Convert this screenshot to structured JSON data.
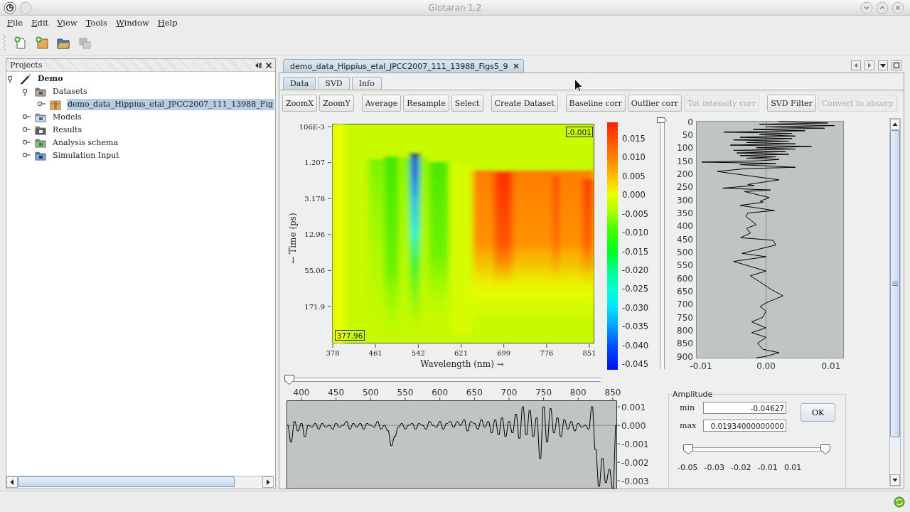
{
  "window": {
    "title": "Glotaran 1.2"
  },
  "menu": [
    "File",
    "Edit",
    "View",
    "Tools",
    "Window",
    "Help"
  ],
  "toolbar": [
    {
      "kind": "add-document",
      "disabled": false
    },
    {
      "kind": "add-folder",
      "disabled": false
    },
    {
      "kind": "folder",
      "disabled": false
    },
    {
      "kind": "windows",
      "disabled": true
    }
  ],
  "projects_panel": {
    "title": "Projects",
    "tree": [
      {
        "label": "Demo",
        "kind": "project",
        "expanded": true,
        "selected": false,
        "children": [
          {
            "label": "Datasets",
            "kind": "datasets",
            "expanded": true,
            "selected": false,
            "children": [
              {
                "label": "demo_data_Hippius_etal_JPCC2007_111_13988_Fig",
                "kind": "dataset",
                "expanded": false,
                "selected": true
              }
            ]
          },
          {
            "label": "Models",
            "kind": "models",
            "expanded": false,
            "selected": false
          },
          {
            "label": "Results",
            "kind": "results",
            "expanded": false,
            "selected": false
          },
          {
            "label": "Analysis schema",
            "kind": "schema",
            "expanded": false,
            "selected": false
          },
          {
            "label": "Simulation Input",
            "kind": "simulation",
            "expanded": false,
            "selected": false
          }
        ]
      }
    ]
  },
  "editor_tab": {
    "title": "demo_data_Hippius_etal_JPCC2007_111_13988_Figs5_9"
  },
  "view_tabs": [
    {
      "label": "Data",
      "selected": true
    },
    {
      "label": "SVD",
      "selected": false
    },
    {
      "label": "Info",
      "selected": false
    }
  ],
  "button_groups": [
    [
      {
        "label": "ZoomX",
        "disabled": false
      },
      {
        "label": "ZoomY",
        "disabled": false
      }
    ],
    [
      {
        "label": "Average",
        "disabled": false
      },
      {
        "label": "Resample",
        "disabled": false
      },
      {
        "label": "Select",
        "disabled": false
      }
    ],
    [
      {
        "label": "Create Dataset",
        "disabled": false
      }
    ],
    [
      {
        "label": "Baseline corr",
        "disabled": false
      },
      {
        "label": "Outlier corr",
        "disabled": false
      },
      {
        "label": "Tot intensity corr",
        "disabled": true
      }
    ],
    [
      {
        "label": "SVD Filter",
        "disabled": false
      },
      {
        "label": "Convert to absorp",
        "disabled": true
      }
    ]
  ],
  "heatmap": {
    "y_axis_label": "← Time (ps)",
    "y_ticks": [
      "106E-3",
      "1.207",
      "3.178",
      "12.96",
      "55.06",
      "171.9"
    ],
    "x_ticks": [
      "378",
      "461",
      "542",
      "621",
      "699",
      "776",
      "851"
    ],
    "x_axis_label": "Wavelength (nm) →",
    "top_readout": "-0.001",
    "bottom_readout": "377.96"
  },
  "color_scale": {
    "ticks": [
      "0.015",
      "0.010",
      "0.005",
      "0.000",
      "-0.005",
      "-0.010",
      "-0.015",
      "-0.020",
      "-0.025",
      "-0.030",
      "-0.035",
      "-0.040",
      "-0.045"
    ]
  },
  "vertical_slider": {
    "level": 0
  },
  "trace_plot": {
    "chart_data": {
      "type": "line",
      "xlim": [
        -0.01077,
        0.01197
      ],
      "ylim": [
        908,
        -3
      ],
      "xticks": [
        {
          "value": -0.01,
          "label": "-0.01"
        },
        {
          "value": 0,
          "label": "0.00"
        },
        {
          "value": 0.01,
          "label": "0.01"
        }
      ],
      "yticks": [
        0,
        50,
        100,
        150,
        200,
        250,
        300,
        350,
        400,
        450,
        500,
        550,
        600,
        650,
        700,
        750,
        800,
        850,
        900
      ],
      "x": [
        0.002,
        0.0095,
        -0.001,
        0.0105,
        0,
        0.009,
        -0.002,
        0.006,
        -0.0065,
        0.004,
        -0.001,
        0.0045,
        -0.004,
        0.004,
        -0.005,
        0.0035,
        -0.003,
        0.0045,
        -0.0055,
        0.007,
        -0.0015,
        0.0045,
        -0.005,
        0.003,
        -0.0045,
        0.0035,
        -0.004,
        0.0015,
        -0.003,
        0.002,
        -0.001,
        -0.0099,
        0.0015,
        -0.004,
        0.0005,
        0.0045,
        -0.003,
        -0.0075,
        -0.0007,
        0.002,
        -0.0028,
        -0.0018,
        -0.0067,
        0.0007,
        -0.0033,
        0.0005,
        -0.0009,
        -0.0004,
        -0.004,
        0.0013,
        -0.0028,
        -0.0031,
        -0.0024,
        -0.0015,
        -0.003,
        -0.0024,
        -0.0039,
        0.0011,
        0.0015,
        -0.0037,
        0,
        -0.005,
        0,
        -0.0024,
        0.0009,
        0.0026,
        0,
        -0.0009,
        0,
        -0.0005,
        -0.0022,
        0,
        -0.0022,
        0,
        -0.0013,
        -0.0005,
        0.002,
        0,
        -0.0015
      ],
      "series": [
        {
          "values": [
            0,
            5,
            10,
            15,
            20,
            25,
            30,
            35,
            40,
            45,
            50,
            55,
            60,
            65,
            70,
            75,
            80,
            85,
            90,
            95,
            100,
            105,
            110,
            115,
            120,
            125,
            130,
            135,
            140,
            145,
            150,
            155,
            160,
            165,
            170,
            175,
            180,
            191,
            214,
            223,
            241,
            245,
            255,
            262,
            268,
            291,
            305,
            309,
            321,
            341,
            350,
            364,
            377,
            395,
            409,
            427,
            445,
            455,
            473,
            505,
            518,
            536,
            573,
            591,
            645,
            668,
            695,
            709,
            727,
            750,
            768,
            791,
            809,
            827,
            850,
            873,
            886,
            900,
            906
          ]
        }
      ]
    }
  },
  "horizontal_slider": {
    "level": 0
  },
  "spectrum_plot": {
    "chart_data": {
      "type": "line",
      "xlim": [
        378.4,
        856.2
      ],
      "ylim": [
        -0.00342,
        0.00135
      ],
      "xticks": [
        400,
        450,
        500,
        550,
        600,
        650,
        700,
        750,
        800,
        850
      ],
      "yticks": [
        {
          "value": 0.001,
          "label": "0.001"
        },
        {
          "value": 0,
          "label": "0.000"
        },
        {
          "value": -0.001,
          "label": "-0.001"
        },
        {
          "value": -0.002,
          "label": "-0.002"
        },
        {
          "value": -0.003,
          "label": "-0.003"
        }
      ],
      "x": [
        380,
        385,
        390,
        395,
        400,
        405,
        410,
        415,
        420,
        425,
        430,
        435,
        440,
        445,
        450,
        455,
        460,
        465,
        470,
        475,
        480,
        485,
        490,
        495,
        500,
        505,
        510,
        515,
        520,
        525,
        530,
        535,
        540,
        545,
        550,
        555,
        560,
        565,
        570,
        575,
        580,
        585,
        590,
        595,
        600,
        605,
        610,
        615,
        620,
        625,
        630,
        635,
        640,
        645,
        650,
        655,
        660,
        665,
        670,
        675,
        680,
        685,
        690,
        695,
        700,
        705,
        710,
        715,
        720,
        725,
        730,
        735,
        740,
        745,
        750,
        755,
        760,
        765,
        770,
        775,
        780,
        785,
        790,
        795,
        800,
        805,
        810,
        815,
        820,
        825,
        830,
        835,
        840,
        845,
        850,
        855
      ],
      "series": [
        {
          "values": [
            0,
            -0.0009,
            0.0002,
            -0.0003,
            0.0001,
            -0.0006,
            0,
            -0.0001,
            0.0001,
            -0.0002,
            0.0001,
            -0.0001,
            0,
            -0.0002,
            0.0001,
            -0.0001,
            0,
            0.0002,
            -0.0002,
            0.0001,
            -0.0001,
            0.0001,
            -0.0002,
            0.0001,
            0,
            -0.0001,
            0.0002,
            -0.0002,
            0,
            -0.0003,
            -0.0011,
            -0.0006,
            -0.0001,
            0.0001,
            -0.0002,
            0,
            0.0001,
            -0.0002,
            0.0001,
            0,
            -0.0002,
            0.0002,
            0,
            -0.0001,
            0.0002,
            -0.0002,
            0.0001,
            0.0002,
            -0.0001,
            0.0002,
            0,
            0.0003,
            -0.0003,
            0.0002,
            0.0001,
            -0.0002,
            0.0003,
            -0.0001,
            0.0002,
            -0.0004,
            0.0003,
            -0.0005,
            0.0004,
            -0.0006,
            0.0002,
            -0.0004,
            0.0006,
            -0.0007,
            0.001,
            -0.0005,
            0.0008,
            -0.0006,
            0.0004,
            -0.0018,
            0.001,
            -0.0009,
            0.0009,
            -0.0004,
            0.0004,
            -0.0006,
            0.0003,
            -0.0002,
            0.0002,
            -0.0003,
            0.0001,
            -0.0001,
            0,
            -0.0002,
            0.001,
            -0.0013,
            -0.0033,
            -0.0018,
            -0.0031,
            -0.0024,
            -0.0034,
            0
          ]
        }
      ]
    }
  },
  "amplitude": {
    "title": "Amplitude",
    "min": {
      "label": "min",
      "value": "-0.04627"
    },
    "max": {
      "label": "max",
      "value": "0.01934000000000"
    },
    "ok_button": "OK",
    "range_slider": {
      "thumbs": [
        {
          "level": 0
        },
        {
          "level": 1
        }
      ],
      "ticks": [
        "-0.05",
        "-0.03",
        "-0.02",
        "-0.01",
        "0.01"
      ]
    }
  }
}
